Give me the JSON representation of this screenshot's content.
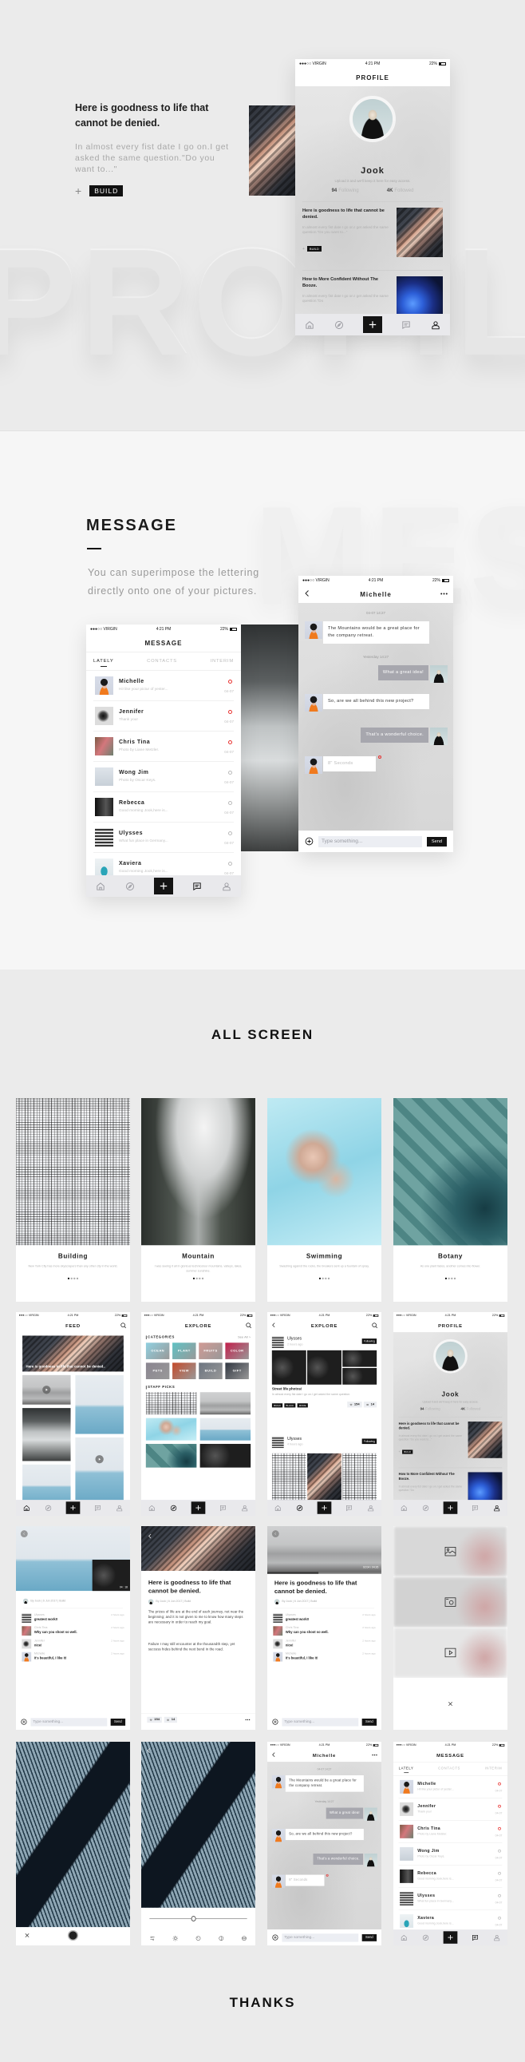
{
  "status": {
    "carrier": "●●●○○ VIRGIN",
    "time": "4:21 PM",
    "battery": "22%"
  },
  "profile_section": {
    "heading": "Here is goodness to life that cannot be denied.",
    "body": "In almost every fist date I go on.I get asked the same question.\"Do you want to...\"",
    "build_label": "BUILD",
    "watermark": "PROFILE"
  },
  "profile_screen": {
    "title": "PROFILE",
    "name": "Jook",
    "bio": "Upload it and we'll keep it here for easy access.",
    "following_count": "94",
    "following_label": "Following",
    "followed_count": "4K",
    "followed_label": "Followed",
    "posts": [
      {
        "title": "Here is goodness to life that cannot be denied.",
        "body": "In almost every fist date I go on.I get asked the same question.\"Do you want to...\"",
        "tag": "BUILD"
      },
      {
        "title": "How to More Confident Without The Booze.",
        "body": "In almost every fist date I go on.I get asked the same question.\"Do"
      }
    ]
  },
  "message_section": {
    "title": "MESSAGE",
    "subtitle_line1": "You can superimpose the lettering",
    "subtitle_line2": "directly onto one of your pictures.",
    "watermark": "MES"
  },
  "message_screen": {
    "title": "MESSAGE",
    "tabs": [
      "LATELY",
      "CONTACTS",
      "INTERIM"
    ],
    "active_tab": "LATELY",
    "items": [
      {
        "name": "Michelle",
        "preview": "Hi! like your pictur of yester...",
        "date": "04-07",
        "unread": true
      },
      {
        "name": "Jennifer",
        "preview": "Thank you!",
        "date": "04-07",
        "unread": true
      },
      {
        "name": "Chris Tina",
        "preview": "Photo by Liane Metzler.",
        "date": "04-07",
        "unread": true
      },
      {
        "name": "Wong Jim",
        "preview": "Photo by Oscar Keys.",
        "date": "04-07",
        "unread": false
      },
      {
        "name": "Rebecca",
        "preview": "Good morning Jook,here is...",
        "date": "04-07",
        "unread": false
      },
      {
        "name": "Ulysses",
        "preview": "What fun place in Germany...",
        "date": "04-07",
        "unread": false
      },
      {
        "name": "Xaviera",
        "preview": "Good morning Jook,here is...",
        "date": "04-07",
        "unread": false
      }
    ]
  },
  "chat_screen": {
    "title": "Michelle",
    "items": [
      {
        "type": "time",
        "text": "04-07 14:27"
      },
      {
        "type": "in",
        "text": "The Mountains would be a great place for the company retreat."
      },
      {
        "type": "time",
        "text": "Yesterday 14:27"
      },
      {
        "type": "out",
        "text": "What a great idea!"
      },
      {
        "type": "in",
        "text": "So, are we all behind this new project?"
      },
      {
        "type": "out",
        "text": "That's a wonderful choice."
      },
      {
        "type": "voice",
        "text": "8\" Seconds",
        "unread": true
      }
    ],
    "input_placeholder": "Type something...",
    "send_label": "Send"
  },
  "all_screen": {
    "title": "ALL SCREEN",
    "onboarding": [
      {
        "title": "Building",
        "desc": "New York City has more skyscrapers than any other city in the world."
      },
      {
        "title": "Mountain",
        "desc": "I was seeing it all in glorious technicolour mountains, valleys, lakes, summer sunshine."
      },
      {
        "title": "Swimming",
        "desc": "Swashing against the rocks, the breakers sent up a fountain of spray."
      },
      {
        "title": "Botany",
        "desc": "As one plant fades, another comes into flower."
      }
    ],
    "feed": {
      "title": "FEED",
      "hero_caption": "Here is goodness to life that cannot be denied.."
    },
    "explore": {
      "title": "EXPLORE",
      "categories_label": "CATEGORIES",
      "see_all": "See All >",
      "categories": [
        "OCEAN",
        "PLANT",
        "FRUITS",
        "COLOR",
        "PETS",
        "VIEW",
        "BUILD",
        "GIFT"
      ],
      "staff_picks_label": "STAFF PICKS"
    },
    "explore_feed": {
      "title": "EXPLORE",
      "posts": [
        {
          "user": "Ulysses",
          "time": "2 hours ago",
          "follow": "Following"
        },
        {
          "user": "Ulysses",
          "time": "4 hours ago",
          "follow": "Following"
        }
      ],
      "post_title": "Street life photos!",
      "post_body": "In almost every fist date I go on.I get asked the same question.",
      "tags": [
        "BUILD",
        "BLACK",
        "MORE"
      ],
      "likes": "154",
      "comments": "14"
    },
    "post": {
      "meta": "By Jook | 6 Jun 2017 | Build",
      "video_time": "04 : 18",
      "comments": [
        {
          "name": "Ulysses",
          "text": "greatest work!!",
          "time": "2 hours ago"
        },
        {
          "name": "Chris Tina",
          "text": "Why can you shoot so well.",
          "time": "2 hours ago"
        },
        {
          "name": "Jennifer",
          "text": "nice!",
          "time": "2 hours ago"
        },
        {
          "name": "Michelle",
          "text": "It's beautiful, I like it!",
          "time": "2 hours ago"
        }
      ]
    },
    "article": {
      "title": "Here is goodness to life that cannot be denied.",
      "meta": "By Jook | 6 Jun 2017 | Build",
      "paragraphs": [
        "The prizes of life are at the end of each journey, not near the beginning; and it is not given to me to know how many steps are necessary in order to reach my goal.",
        "Failure I may still encounter at the thousandth step, yet success hides behind the next bend in the road."
      ],
      "likes": "154",
      "comments": "14",
      "video_time": "02:04 / 04:26",
      "video_progress": 0.45
    },
    "editor": {
      "slider_value": 0.43
    },
    "thanks": "THANKS"
  },
  "colors": {
    "accent_dark": "#141414",
    "unread_red": "#e8312f",
    "bubble_out": "#a7a7ae",
    "tabbar": "#e9e9ec"
  }
}
